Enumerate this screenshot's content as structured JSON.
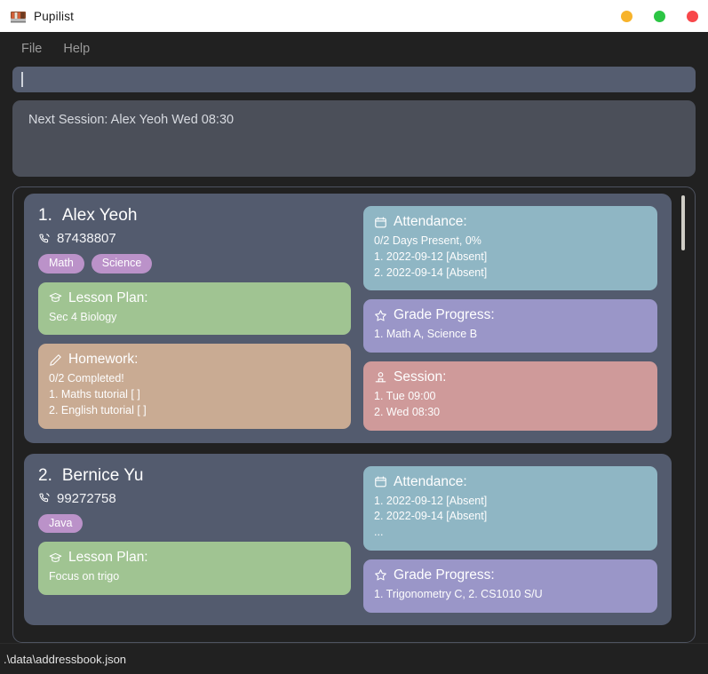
{
  "titlebar": {
    "app_name": "Pupilist",
    "icon": "books-icon",
    "window_controls": [
      {
        "name": "minimize",
        "color": "#f7b32b"
      },
      {
        "name": "maximize",
        "color": "#2cc544"
      },
      {
        "name": "close",
        "color": "#f8474a"
      }
    ]
  },
  "menubar": {
    "items": [
      {
        "label": "File"
      },
      {
        "label": "Help"
      }
    ]
  },
  "search": {
    "value": "",
    "placeholder": ""
  },
  "next_session": {
    "text": "Next Session: Alex Yeoh Wed 08:30"
  },
  "section_labels": {
    "lesson_plan": "Lesson Plan:",
    "homework": "Homework:",
    "attendance": "Attendance:",
    "grade_progress": "Grade Progress:",
    "session": "Session:"
  },
  "students": [
    {
      "index": "1.",
      "name": "Alex Yeoh",
      "phone": "87438807",
      "tags": [
        "Math",
        "Science"
      ],
      "lesson_plan": [
        "Sec 4 Biology"
      ],
      "homework": [
        "0/2 Completed!",
        "1. Maths tutorial [ ]",
        "2. English tutorial [ ]"
      ],
      "attendance": [
        "0/2 Days Present, 0%",
        "1. 2022-09-12 [Absent]",
        "2. 2022-09-14 [Absent]"
      ],
      "grade_progress": [
        "1. Math A, Science B"
      ],
      "session": [
        "1. Tue 09:00",
        "2. Wed 08:30"
      ]
    },
    {
      "index": "2.",
      "name": "Bernice Yu",
      "phone": "99272758",
      "tags": [
        "Java"
      ],
      "lesson_plan": [
        "Focus on trigo"
      ],
      "homework": [],
      "attendance": [
        "1. 2022-09-12 [Absent]",
        "2. 2022-09-14 [Absent]",
        "..."
      ],
      "grade_progress": [
        "1. Trigonometry C, 2. CS1010 S/U"
      ],
      "session": []
    }
  ],
  "statusbar": {
    "file_path": ".\\data\\addressbook.json"
  },
  "colors": {
    "lesson_plan": "#a0c492",
    "homework": "#c9ab93",
    "attendance": "#8fb6c4",
    "grade_progress": "#9a96c8",
    "session": "#cf9a9a",
    "tag": "#bb92c9",
    "card_bg": "#535b6e",
    "window_bg": "#212121"
  }
}
